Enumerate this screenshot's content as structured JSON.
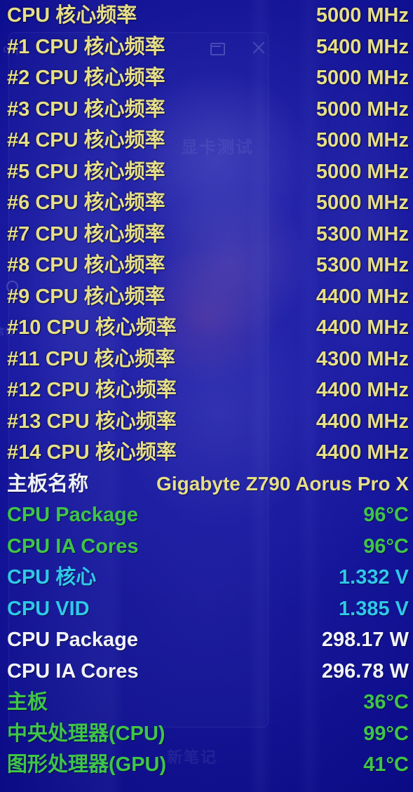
{
  "overlay": {
    "type": "hardware-monitor-osd",
    "colors": {
      "background_blue": "#10109c",
      "yellow": "#e6de8a",
      "white": "#f2f3fa",
      "green": "#3fc449",
      "cyan": "#2fc8ea"
    }
  },
  "window_controls": {
    "maximize_label": "Maximize",
    "close_label": "Close"
  },
  "watermarks": {
    "middle": "显卡测试",
    "bottom": "新笔记",
    "left": "言论",
    "top_left": "qqq"
  },
  "rows": [
    {
      "label": "CPU 核心频率",
      "value": "5000 MHz",
      "style": "c-yellow"
    },
    {
      "label": "#1 CPU 核心频率",
      "value": "5400 MHz",
      "style": "c-yellow"
    },
    {
      "label": "#2 CPU 核心频率",
      "value": "5000 MHz",
      "style": "c-yellow"
    },
    {
      "label": "#3 CPU 核心频率",
      "value": "5000 MHz",
      "style": "c-yellow"
    },
    {
      "label": "#4 CPU 核心频率",
      "value": "5000 MHz",
      "style": "c-yellow"
    },
    {
      "label": "#5 CPU 核心频率",
      "value": "5000 MHz",
      "style": "c-yellow"
    },
    {
      "label": "#6 CPU 核心频率",
      "value": "5000 MHz",
      "style": "c-yellow"
    },
    {
      "label": "#7 CPU 核心频率",
      "value": "5300 MHz",
      "style": "c-yellow"
    },
    {
      "label": "#8 CPU 核心频率",
      "value": "5300 MHz",
      "style": "c-yellow"
    },
    {
      "label": "#9 CPU 核心频率",
      "value": "4400 MHz",
      "style": "c-yellow"
    },
    {
      "label": "#10 CPU 核心频率",
      "value": "4400 MHz",
      "style": "c-yellow"
    },
    {
      "label": "#11 CPU 核心频率",
      "value": "4300 MHz",
      "style": "c-yellow"
    },
    {
      "label": "#12 CPU 核心频率",
      "value": "4400 MHz",
      "style": "c-yellow"
    },
    {
      "label": "#13 CPU 核心频率",
      "value": "4400 MHz",
      "style": "c-yellow"
    },
    {
      "label": "#14 CPU 核心频率",
      "value": "4400 MHz",
      "style": "c-yellow"
    },
    {
      "label": "主板名称",
      "value": "Gigabyte Z790 Aorus Pro X",
      "style": "c-mixed"
    },
    {
      "label": "CPU Package",
      "value": "96°C",
      "style": "c-green"
    },
    {
      "label": "CPU IA Cores",
      "value": "96°C",
      "style": "c-green"
    },
    {
      "label": "CPU 核心",
      "value": "1.332 V",
      "style": "c-cyan"
    },
    {
      "label": "CPU VID",
      "value": "1.385 V",
      "style": "c-cyan"
    },
    {
      "label": "CPU Package",
      "value": "298.17 W",
      "style": "c-white"
    },
    {
      "label": "CPU IA Cores",
      "value": "296.78 W",
      "style": "c-white"
    },
    {
      "label": "主板",
      "value": "36°C",
      "style": "c-green"
    },
    {
      "label": "中央处理器(CPU)",
      "value": "99°C",
      "style": "c-green"
    },
    {
      "label": "图形处理器(GPU)",
      "value": "41°C",
      "style": "c-green"
    }
  ]
}
